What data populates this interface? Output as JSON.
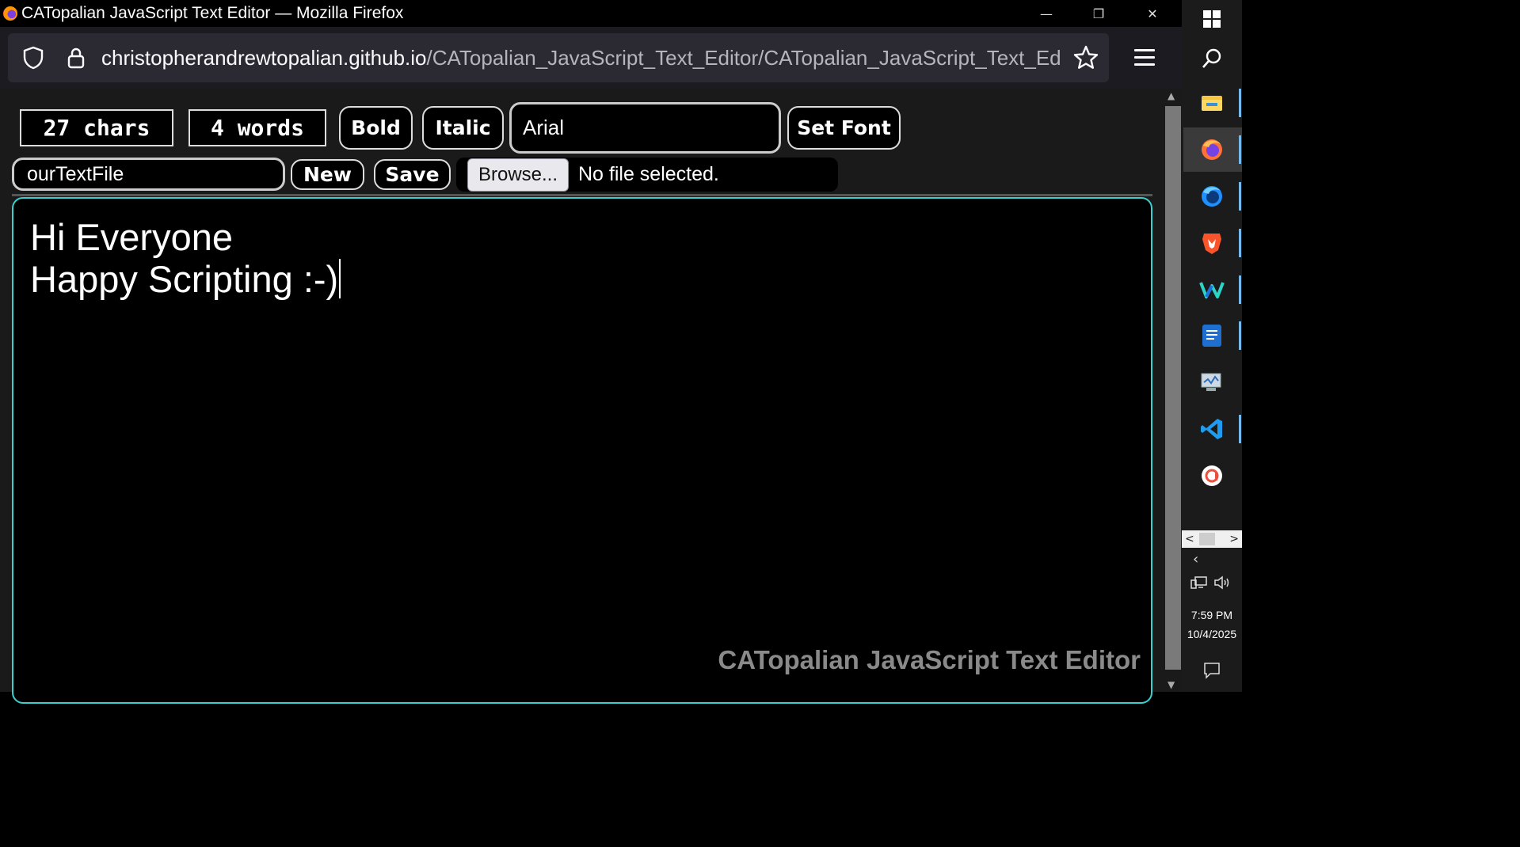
{
  "window": {
    "title": "CATopalian JavaScript Text Editor — Mozilla Firefox",
    "minimize_glyph": "—",
    "restore_glyph": "❐",
    "close_glyph": "✕"
  },
  "urlbar": {
    "host": "christopherandrewtopalian.github.io",
    "path": "/CATopalian_JavaScript_Text_Editor/CATopalian_JavaScript_Text_Editor"
  },
  "toolbar": {
    "char_count": "27 chars",
    "word_count": "4 words",
    "bold_label": "Bold",
    "italic_label": "Italic",
    "font_value": "Arial",
    "set_font_label": "Set Font"
  },
  "filebar": {
    "filename_value": "ourTextFile",
    "new_label": "New",
    "save_label": "Save",
    "browse_label": "Browse...",
    "no_file_text": "No file selected."
  },
  "editor": {
    "line1": "Hi Everyone",
    "line2": "Happy Scripting :-)",
    "watermark": "CATopalian JavaScript Text Editor"
  },
  "taskbar": {
    "icons": [
      "windows-start-icon",
      "search-icon",
      "file-explorer-icon",
      "firefox-icon",
      "firefox-developer-icon",
      "brave-icon",
      "wondershare-icon",
      "document-icon",
      "network-monitor-icon",
      "vscode-icon",
      "app-icon"
    ],
    "time": "7:59 PM",
    "date": "10/4/2025"
  },
  "colors": {
    "editor_border": "#3ad0d0",
    "watermark": "#8a8a8a",
    "taskbar_accent": "#76b9ed"
  }
}
